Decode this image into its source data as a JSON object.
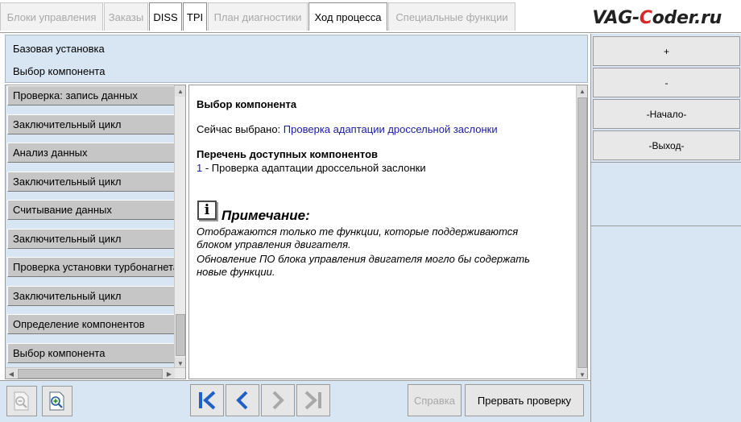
{
  "tabs": [
    {
      "label": "Блоки управления",
      "active": false
    },
    {
      "label": "Заказы",
      "active": false
    },
    {
      "label": "DISS",
      "active": true
    },
    {
      "label": "TPI",
      "active": true
    },
    {
      "label": "План диагностики",
      "active": false
    },
    {
      "label": "Ход процесса",
      "active": true
    },
    {
      "label": "Специальные функции",
      "active": false
    }
  ],
  "watermark": {
    "part1": "VAG-",
    "part2": "C",
    "part3": "oder.ru"
  },
  "header": {
    "line1": "Базовая установка",
    "line2": "Выбор компонента"
  },
  "side_buttons": {
    "plus": "+",
    "minus": "-",
    "start": "-Начало-",
    "exit": "-Выход-"
  },
  "steps": [
    "Проверка: запись данных",
    "Заключительный цикл",
    "Анализ данных",
    "Заключительный цикл",
    "Считывание данных",
    "Заключительный цикл",
    "Проверка установки турбонагнетателя",
    "Заключительный цикл",
    "Определение компонентов",
    "Выбор компонента"
  ],
  "content": {
    "title": "Выбор компонента",
    "selected_label": "Сейчас выбрано: ",
    "selected_value": "Проверка адаптации дроссельной заслонки",
    "list_header": "Перечень доступных компонентов",
    "item_number": "1",
    "item_text": " - Проверка адаптации дроссельной заслонки",
    "note_icon": "i",
    "note_title": "Примечание:",
    "note_lines": [
      "Отображаются только те функции, которые поддерживаются",
      "блоком управления двигателя.",
      "Обновление ПО блока управления двигателя могло бы содержать",
      "новые функции."
    ]
  },
  "bottom": {
    "help_label": "Справка",
    "abort_label": "Прервать проверку"
  },
  "colors": {
    "panel_bg": "#d8e5f2",
    "link": "#1a1aa8",
    "nav_blue": "#1f5fc8",
    "disabled": "#a8a8a8"
  }
}
